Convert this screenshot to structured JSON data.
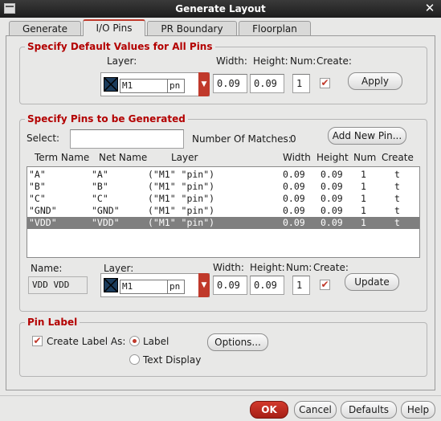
{
  "window": {
    "title": "Generate Layout"
  },
  "tabs": [
    {
      "label": "Generate"
    },
    {
      "label": "I/O Pins"
    },
    {
      "label": "PR Boundary"
    },
    {
      "label": "Floorplan"
    }
  ],
  "defaults": {
    "title": "Specify Default Values for All Pins",
    "layer_label": "Layer:",
    "width_label": "Width:",
    "height_label": "Height:",
    "num_label": "Num:",
    "create_label": "Create:",
    "layer_name": "M1",
    "layer_purpose": "pn",
    "width": "0.09",
    "height": "0.09",
    "num": "1",
    "create_checked": true,
    "apply_label": "Apply"
  },
  "pins": {
    "title": "Specify Pins to be Generated",
    "select_label": "Select:",
    "select_value": "",
    "matches_label": "Number Of Matches:",
    "matches_value": "0",
    "add_label": "Add New Pin...",
    "columns": [
      "Term Name",
      "Net Name",
      "Layer",
      "Width",
      "Height",
      "Num",
      "Create"
    ],
    "rows": [
      {
        "term": "\"A\"",
        "net": "\"A\"",
        "layer": "(\"M1\" \"pin\")",
        "width": "0.09",
        "height": "0.09",
        "num": "1",
        "create": "t"
      },
      {
        "term": "\"B\"",
        "net": "\"B\"",
        "layer": "(\"M1\" \"pin\")",
        "width": "0.09",
        "height": "0.09",
        "num": "1",
        "create": "t"
      },
      {
        "term": "\"C\"",
        "net": "\"C\"",
        "layer": "(\"M1\" \"pin\")",
        "width": "0.09",
        "height": "0.09",
        "num": "1",
        "create": "t"
      },
      {
        "term": "\"GND\"",
        "net": "\"GND\"",
        "layer": "(\"M1\" \"pin\")",
        "width": "0.09",
        "height": "0.09",
        "num": "1",
        "create": "t"
      },
      {
        "term": "\"VDD\"",
        "net": "\"VDD\"",
        "layer": "(\"M1\" \"pin\")",
        "width": "0.09",
        "height": "0.09",
        "num": "1",
        "create": "t"
      }
    ],
    "selected_row_index": 4,
    "edit": {
      "name_label": "Name:",
      "name_value": "VDD VDD",
      "layer_label": "Layer:",
      "width_label": "Width:",
      "height_label": "Height:",
      "num_label": "Num:",
      "create_label": "Create:",
      "layer_name": "M1",
      "layer_purpose": "pn",
      "width": "0.09",
      "height": "0.09",
      "num": "1",
      "create_checked": true,
      "update_label": "Update"
    }
  },
  "pin_label": {
    "title": "Pin Label",
    "create_label_text": "Create Label As:",
    "create_checked": true,
    "option_label": "Label",
    "option_text_display": "Text Display",
    "selected_option": "Label",
    "options_button": "Options..."
  },
  "footer": {
    "ok": "OK",
    "cancel": "Cancel",
    "defaults": "Defaults",
    "help": "Help"
  },
  "colors": {
    "accent": "#c0392b",
    "selected_row": "#7f7f7f",
    "section_title": "#b30000"
  },
  "icons": [
    "window-menu-icon",
    "close-icon",
    "layer-swatch-icon",
    "dropdown-arrow-icon",
    "checkmark-icon"
  ]
}
